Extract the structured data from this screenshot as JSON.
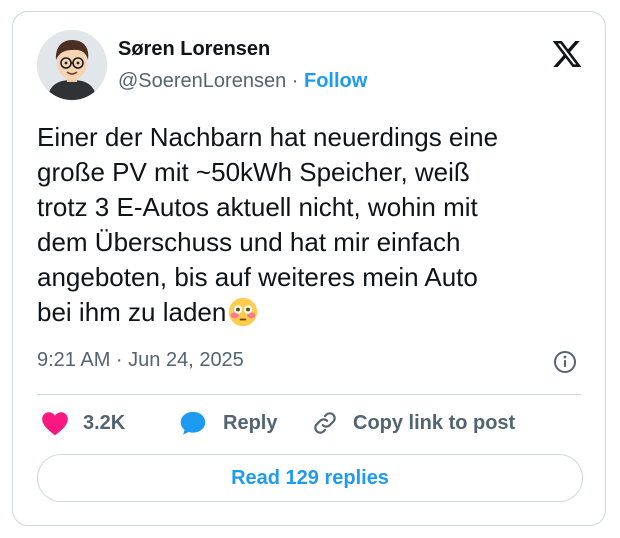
{
  "author": {
    "name": "Søren Lorensen",
    "handle": "@SoerenLorensen",
    "separator": "·",
    "follow_label": "Follow"
  },
  "tweet": {
    "lines": [
      "Einer der Nachbarn hat neuerdings eine",
      "große PV mit ~50kWh Speicher, weiß",
      "trotz 3 E-Autos aktuell nicht, wohin mit",
      "dem Überschuss und hat mir einfach",
      "angeboten, bis auf weiteres mein Auto",
      "bei ihm zu laden"
    ],
    "emoji": "flushed-face-emoji"
  },
  "meta": {
    "timestamp": "9:21 AM · Jun 24, 2025"
  },
  "actions": {
    "likes": "3.2K",
    "reply_label": "Reply",
    "copy_label": "Copy link to post"
  },
  "read_replies_label": "Read 129 replies",
  "icons": {
    "logo": "x-logo-icon",
    "like": "heart-icon",
    "reply": "speech-bubble-icon",
    "copy": "link-icon",
    "info": "info-icon"
  },
  "colors": {
    "accent": "#1d9bf0",
    "like": "#f91880",
    "secondary_text": "#536471",
    "border": "#cfd9de"
  }
}
